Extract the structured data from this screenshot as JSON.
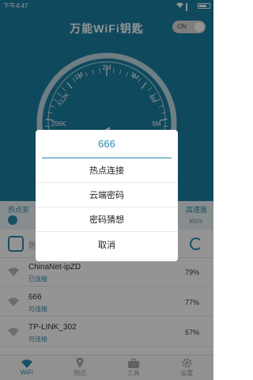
{
  "status_bar": {
    "time": "下午4:47"
  },
  "header": {
    "title": "万能WiFi钥匙",
    "toggle_label": "ON",
    "gauge_ticks": [
      "256K",
      "512K",
      "1M",
      "2M",
      "3M",
      "4M",
      "5M"
    ]
  },
  "info_strip": {
    "hotspot_label": "热点安",
    "speed_label": "高速度",
    "speed_value": "kb/s"
  },
  "current": {
    "name": "附"
  },
  "networks": [
    {
      "name": "ChinaNet-ipZD",
      "status": "已连接",
      "signal": "79%"
    },
    {
      "name": "666",
      "status": "可连接",
      "signal": "77%"
    },
    {
      "name": "TP-LINK_302",
      "status": "可连接",
      "signal": "57%"
    }
  ],
  "dialog": {
    "title": "666",
    "options": [
      "热点连接",
      "云端密码",
      "密码猜想",
      "取消"
    ]
  },
  "bottom_nav": [
    {
      "label": "WiFi",
      "icon": "wifi-icon"
    },
    {
      "label": "附近",
      "icon": "location-pin-icon"
    },
    {
      "label": "工具",
      "icon": "toolbox-icon"
    },
    {
      "label": "设置",
      "icon": "gear-icon"
    }
  ],
  "colors": {
    "primary": "#1a7fa1",
    "accent": "#2a8bb0"
  }
}
